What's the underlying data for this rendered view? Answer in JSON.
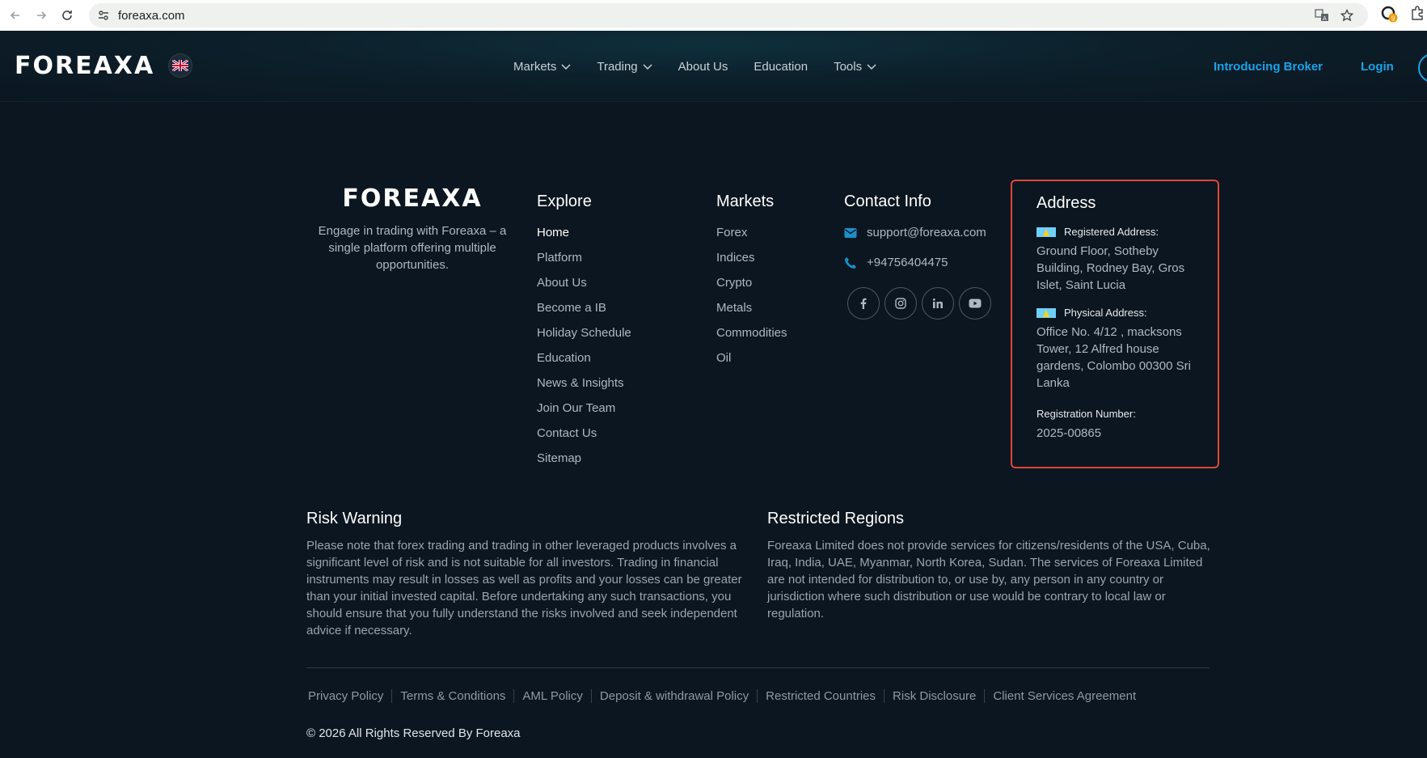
{
  "browser": {
    "url": "foreaxa.com",
    "extension_badge": "9"
  },
  "header": {
    "logo": "FOREAXA",
    "nav": [
      {
        "label": "Markets",
        "dropdown": true
      },
      {
        "label": "Trading",
        "dropdown": true
      },
      {
        "label": "About Us",
        "dropdown": false
      },
      {
        "label": "Education",
        "dropdown": false
      },
      {
        "label": "Tools",
        "dropdown": true
      }
    ],
    "introducing_broker": "Introducing Broker",
    "login": "Login"
  },
  "footer": {
    "brand": {
      "logo": "FOREAXA",
      "description": "Engage in trading with Foreaxa – a single platform offering multiple opportunities."
    },
    "explore": {
      "title": "Explore",
      "links": [
        "Home",
        "Platform",
        "About Us",
        "Become a IB",
        "Holiday Schedule",
        "Education",
        "News & Insights",
        "Join Our Team",
        "Contact Us",
        "Sitemap"
      ]
    },
    "markets": {
      "title": "Markets",
      "links": [
        "Forex",
        "Indices",
        "Crypto",
        "Metals",
        "Commodities",
        "Oil"
      ]
    },
    "contact": {
      "title": "Contact Info",
      "email": "support@foreaxa.com",
      "phone": "+94756404475",
      "socials": [
        "facebook-icon",
        "instagram-icon",
        "linkedin-icon",
        "youtube-icon"
      ]
    },
    "address": {
      "title": "Address",
      "registered_label": "Registered Address:",
      "registered_text": "Ground Floor, Sotheby Building, Rodney Bay, Gros Islet, Saint Lucia",
      "physical_label": "Physical Address:",
      "physical_text": "Office No. 4/12 , macksons Tower, 12 Alfred house gardens, Colombo 00300 Sri Lanka",
      "registration_label": "Registration Number:",
      "registration_number": "2025-00865"
    },
    "risk": {
      "title": "Risk Warning",
      "text": "Please note that forex trading and trading in other leveraged products involves a significant level of risk and is not suitable for all investors. Trading in financial instruments may result in losses as well as profits and your losses can be greater than your initial invested capital. Before undertaking any such transactions, you should ensure that you fully understand the risks involved and seek independent advice if necessary."
    },
    "restricted": {
      "title": "Restricted Regions",
      "text": "Foreaxa Limited does not provide services for citizens/residents of the USA, Cuba, Iraq, India, UAE, Myanmar, North Korea, Sudan. The services of Foreaxa Limited are not intended for distribution to, or use by, any person in any country or jurisdiction where such distribution or use would be contrary to local law or regulation."
    },
    "policies": [
      "Privacy Policy",
      "Terms & Conditions",
      "AML Policy",
      "Deposit & withdrawal Policy",
      "Restricted Countries",
      "Risk Disclosure",
      "Client Services Agreement"
    ],
    "copyright": "© 2026 All Rights Reserved By Foreaxa"
  },
  "colors": {
    "background": "#0b1620",
    "accent": "#1aa3e8",
    "highlight_border": "#e0463a"
  }
}
